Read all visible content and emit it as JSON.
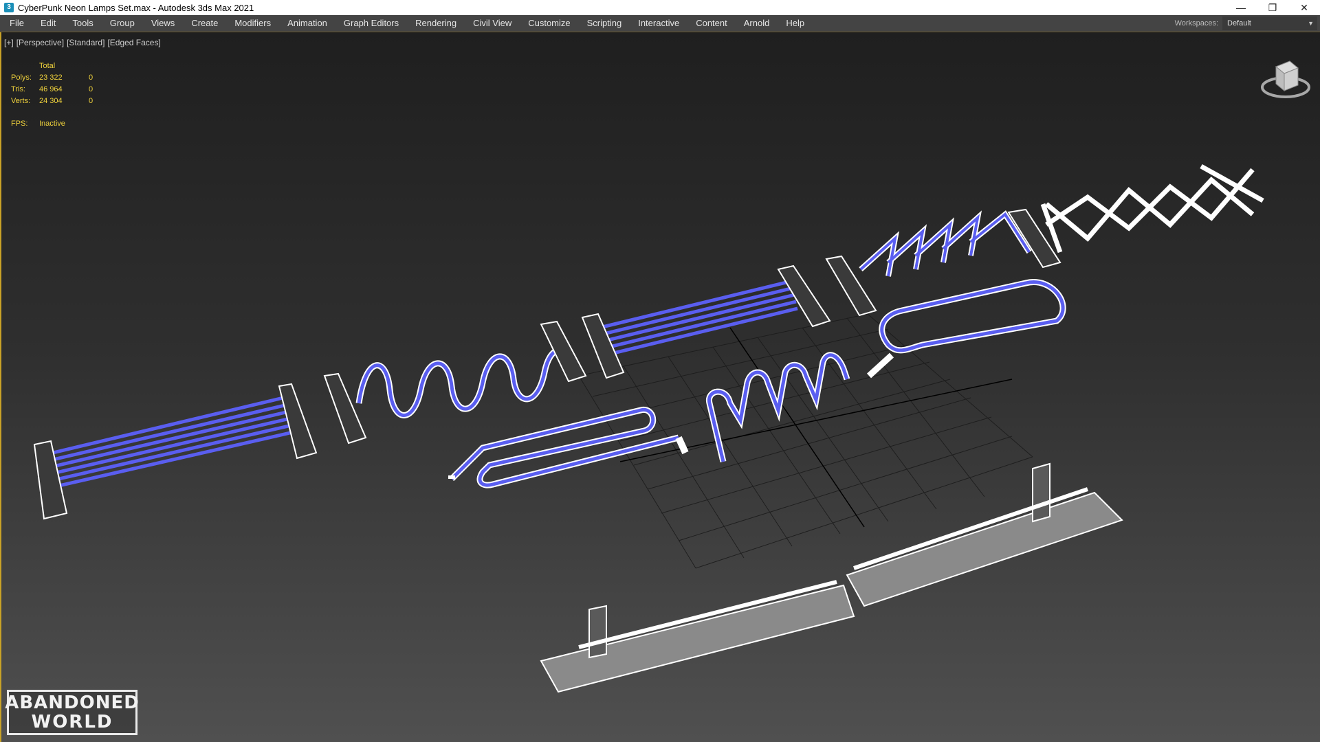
{
  "window": {
    "title": "CyberPunk Neon Lamps Set.max - Autodesk 3ds Max 2021",
    "icon": "3dsmax-app-icon",
    "controls": [
      "minimize-icon",
      "restore-icon",
      "close-icon"
    ]
  },
  "menu": {
    "items": [
      "File",
      "Edit",
      "Tools",
      "Group",
      "Views",
      "Create",
      "Modifiers",
      "Animation",
      "Graph Editors",
      "Rendering",
      "Civil View",
      "Customize",
      "Scripting",
      "Interactive",
      "Content",
      "Arnold",
      "Help"
    ],
    "workspace_label": "Workspaces:",
    "workspace_value": "Default"
  },
  "viewport": {
    "label_plus": "[+]",
    "label_view": "[Perspective]",
    "label_shading": "[Standard]",
    "label_mode": "[Edged Faces]"
  },
  "stats": {
    "header": "Total",
    "polys_label": "Polys:",
    "polys_total": "23 322",
    "polys_sel": "0",
    "tris_label": "Tris:",
    "tris_total": "46 964",
    "tris_sel": "0",
    "verts_label": "Verts:",
    "verts_total": "24 304",
    "verts_sel": "0",
    "fps_label": "FPS:",
    "fps_value": "Inactive"
  },
  "logo": {
    "line1": "ABANDONED",
    "line2": "WORLD"
  },
  "colors": {
    "neon": "#5a5ef0",
    "frame": "#ffffff",
    "stats": "#f0d23c",
    "accent": "#c9a227",
    "viewport_bg": "#2e2e2e"
  }
}
